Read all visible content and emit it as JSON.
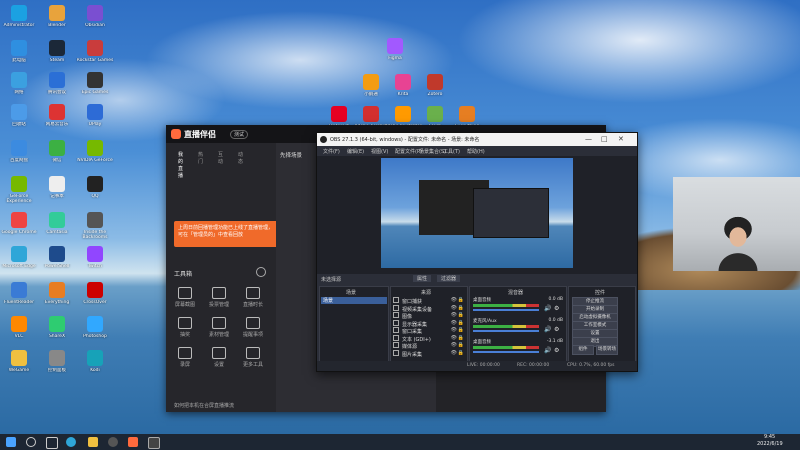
{
  "desktop_icons": [
    {
      "label": "Administrator"
    },
    {
      "label": "Blender"
    },
    {
      "label": "Obsidian"
    },
    {
      "label": "此电脑"
    },
    {
      "label": "Steam"
    },
    {
      "label": "Rockstar Games"
    },
    {
      "label": "网络"
    },
    {
      "label": "腾讯会议"
    },
    {
      "label": "Epic Games"
    },
    {
      "label": "回收站"
    },
    {
      "label": "网易云音乐"
    },
    {
      "label": "UPlay"
    },
    {
      "label": "百度网盘"
    },
    {
      "label": "微信"
    },
    {
      "label": "NVIDIA GeForce"
    },
    {
      "label": "GeForce Experience"
    },
    {
      "label": "记事本"
    },
    {
      "label": "QQ"
    },
    {
      "label": "Google Chrome"
    },
    {
      "label": "Camtasia"
    },
    {
      "label": "Inside the Backrooms"
    },
    {
      "label": "Microsoft Edge"
    },
    {
      "label": "PowerShell"
    },
    {
      "label": "Twitch"
    },
    {
      "label": "FluentReader"
    },
    {
      "label": "Everything"
    },
    {
      "label": "CrossOver"
    },
    {
      "label": "VLC"
    },
    {
      "label": "ShareX"
    },
    {
      "label": "Photoshop"
    },
    {
      "label": "WeGame"
    },
    {
      "label": "控制面板"
    },
    {
      "label": "Kodi"
    },
    {
      "label": "Figma"
    },
    {
      "label": "小鹅通"
    },
    {
      "label": "Krita"
    },
    {
      "label": "Zotero"
    },
    {
      "label": "Pinterest"
    },
    {
      "label": "Adobe Acrobat"
    },
    {
      "label": "Adobe Illustrator"
    },
    {
      "label": "Clash"
    },
    {
      "label": "Everything"
    }
  ],
  "app": {
    "title": "直播伴侣",
    "version_badge": "测试",
    "tabs": [
      "我的直播",
      "热门",
      "互动",
      "动态"
    ],
    "toast": "上周日前回播管理功能已上线了直播管理，可在「管理员的」中查看回放",
    "tools_header": "工具箱",
    "tools": [
      "屏幕截图",
      "投票管理",
      "直播时长",
      "抽奖",
      "素材管理",
      "提醒事项",
      "录屏",
      "设置",
      "更多工具"
    ],
    "start_notice": "先择场景",
    "bottom_notice": "如何把本机在合屏直播推流"
  },
  "obs": {
    "title": "OBS 27.1.3 (64-bit, windows) - 配置文件: 未命名 - 场景: 未命名",
    "menu": [
      "文件(F)",
      "编辑(E)",
      "视图(V)",
      "配置文件(P)",
      "场景集合(S)",
      "工具(T)",
      "帮助(H)"
    ],
    "scene_hint": "未选择源",
    "source_buttons": [
      "属性",
      "过滤器"
    ],
    "docks": {
      "scenes": {
        "header": "场景",
        "items": [
          "场景"
        ]
      },
      "sources": {
        "header": "来源",
        "items": [
          "窗口捕获",
          "视频采集设备",
          "图像",
          "显示器采集",
          "窗口采集",
          "文本 (GDI+)",
          "媒体源",
          "图片采集"
        ]
      },
      "mixer": {
        "header": "混音器",
        "channels": [
          {
            "name": "桌面音频",
            "level": "0.0 dB"
          },
          {
            "name": "麦克风/Aux",
            "level": "0.0 dB"
          },
          {
            "name": "桌面音频",
            "level": "-3.1 dB"
          }
        ]
      },
      "controls": {
        "header": "控件",
        "buttons": [
          "停止推流",
          "开始录制",
          "启动虚拟摄像机",
          "工作室模式",
          "设置",
          "退出",
          "组件",
          "场景转场"
        ]
      }
    },
    "status": {
      "dropped": "LIVE: 00:00:00",
      "rec": "REC: 00:00:00",
      "cpu": "CPU: 0.7%, 60.00 fps"
    }
  },
  "taskbar": {
    "time": "9:45",
    "date": "2022/6/19"
  }
}
